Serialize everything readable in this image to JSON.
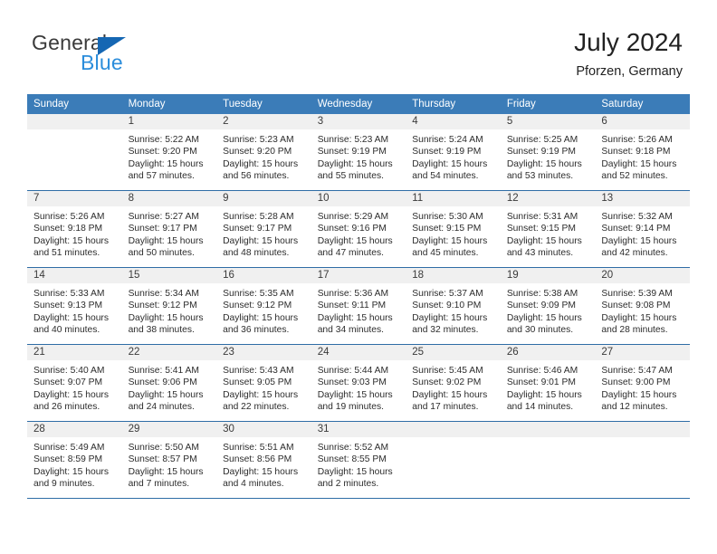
{
  "brand": {
    "name_top": "General",
    "name_bottom": "Blue",
    "triangle_color": "#1567b3",
    "blue_text_color": "#2b8ddb"
  },
  "header": {
    "title": "July 2024",
    "subtitle": "Pforzen, Germany",
    "accent_color": "#3b7cb8",
    "row_rule_color": "#2f6da6",
    "daynum_band_color": "#f0f0f0"
  },
  "weekday_headers": [
    "Sunday",
    "Monday",
    "Tuesday",
    "Wednesday",
    "Thursday",
    "Friday",
    "Saturday"
  ],
  "weeks": [
    [
      {
        "day": "",
        "sunrise": "",
        "sunset": "",
        "daylight_line1": "",
        "daylight_line2": ""
      },
      {
        "day": "1",
        "sunrise": "Sunrise: 5:22 AM",
        "sunset": "Sunset: 9:20 PM",
        "daylight_line1": "Daylight: 15 hours",
        "daylight_line2": "and 57 minutes."
      },
      {
        "day": "2",
        "sunrise": "Sunrise: 5:23 AM",
        "sunset": "Sunset: 9:20 PM",
        "daylight_line1": "Daylight: 15 hours",
        "daylight_line2": "and 56 minutes."
      },
      {
        "day": "3",
        "sunrise": "Sunrise: 5:23 AM",
        "sunset": "Sunset: 9:19 PM",
        "daylight_line1": "Daylight: 15 hours",
        "daylight_line2": "and 55 minutes."
      },
      {
        "day": "4",
        "sunrise": "Sunrise: 5:24 AM",
        "sunset": "Sunset: 9:19 PM",
        "daylight_line1": "Daylight: 15 hours",
        "daylight_line2": "and 54 minutes."
      },
      {
        "day": "5",
        "sunrise": "Sunrise: 5:25 AM",
        "sunset": "Sunset: 9:19 PM",
        "daylight_line1": "Daylight: 15 hours",
        "daylight_line2": "and 53 minutes."
      },
      {
        "day": "6",
        "sunrise": "Sunrise: 5:26 AM",
        "sunset": "Sunset: 9:18 PM",
        "daylight_line1": "Daylight: 15 hours",
        "daylight_line2": "and 52 minutes."
      }
    ],
    [
      {
        "day": "7",
        "sunrise": "Sunrise: 5:26 AM",
        "sunset": "Sunset: 9:18 PM",
        "daylight_line1": "Daylight: 15 hours",
        "daylight_line2": "and 51 minutes."
      },
      {
        "day": "8",
        "sunrise": "Sunrise: 5:27 AM",
        "sunset": "Sunset: 9:17 PM",
        "daylight_line1": "Daylight: 15 hours",
        "daylight_line2": "and 50 minutes."
      },
      {
        "day": "9",
        "sunrise": "Sunrise: 5:28 AM",
        "sunset": "Sunset: 9:17 PM",
        "daylight_line1": "Daylight: 15 hours",
        "daylight_line2": "and 48 minutes."
      },
      {
        "day": "10",
        "sunrise": "Sunrise: 5:29 AM",
        "sunset": "Sunset: 9:16 PM",
        "daylight_line1": "Daylight: 15 hours",
        "daylight_line2": "and 47 minutes."
      },
      {
        "day": "11",
        "sunrise": "Sunrise: 5:30 AM",
        "sunset": "Sunset: 9:15 PM",
        "daylight_line1": "Daylight: 15 hours",
        "daylight_line2": "and 45 minutes."
      },
      {
        "day": "12",
        "sunrise": "Sunrise: 5:31 AM",
        "sunset": "Sunset: 9:15 PM",
        "daylight_line1": "Daylight: 15 hours",
        "daylight_line2": "and 43 minutes."
      },
      {
        "day": "13",
        "sunrise": "Sunrise: 5:32 AM",
        "sunset": "Sunset: 9:14 PM",
        "daylight_line1": "Daylight: 15 hours",
        "daylight_line2": "and 42 minutes."
      }
    ],
    [
      {
        "day": "14",
        "sunrise": "Sunrise: 5:33 AM",
        "sunset": "Sunset: 9:13 PM",
        "daylight_line1": "Daylight: 15 hours",
        "daylight_line2": "and 40 minutes."
      },
      {
        "day": "15",
        "sunrise": "Sunrise: 5:34 AM",
        "sunset": "Sunset: 9:12 PM",
        "daylight_line1": "Daylight: 15 hours",
        "daylight_line2": "and 38 minutes."
      },
      {
        "day": "16",
        "sunrise": "Sunrise: 5:35 AM",
        "sunset": "Sunset: 9:12 PM",
        "daylight_line1": "Daylight: 15 hours",
        "daylight_line2": "and 36 minutes."
      },
      {
        "day": "17",
        "sunrise": "Sunrise: 5:36 AM",
        "sunset": "Sunset: 9:11 PM",
        "daylight_line1": "Daylight: 15 hours",
        "daylight_line2": "and 34 minutes."
      },
      {
        "day": "18",
        "sunrise": "Sunrise: 5:37 AM",
        "sunset": "Sunset: 9:10 PM",
        "daylight_line1": "Daylight: 15 hours",
        "daylight_line2": "and 32 minutes."
      },
      {
        "day": "19",
        "sunrise": "Sunrise: 5:38 AM",
        "sunset": "Sunset: 9:09 PM",
        "daylight_line1": "Daylight: 15 hours",
        "daylight_line2": "and 30 minutes."
      },
      {
        "day": "20",
        "sunrise": "Sunrise: 5:39 AM",
        "sunset": "Sunset: 9:08 PM",
        "daylight_line1": "Daylight: 15 hours",
        "daylight_line2": "and 28 minutes."
      }
    ],
    [
      {
        "day": "21",
        "sunrise": "Sunrise: 5:40 AM",
        "sunset": "Sunset: 9:07 PM",
        "daylight_line1": "Daylight: 15 hours",
        "daylight_line2": "and 26 minutes."
      },
      {
        "day": "22",
        "sunrise": "Sunrise: 5:41 AM",
        "sunset": "Sunset: 9:06 PM",
        "daylight_line1": "Daylight: 15 hours",
        "daylight_line2": "and 24 minutes."
      },
      {
        "day": "23",
        "sunrise": "Sunrise: 5:43 AM",
        "sunset": "Sunset: 9:05 PM",
        "daylight_line1": "Daylight: 15 hours",
        "daylight_line2": "and 22 minutes."
      },
      {
        "day": "24",
        "sunrise": "Sunrise: 5:44 AM",
        "sunset": "Sunset: 9:03 PM",
        "daylight_line1": "Daylight: 15 hours",
        "daylight_line2": "and 19 minutes."
      },
      {
        "day": "25",
        "sunrise": "Sunrise: 5:45 AM",
        "sunset": "Sunset: 9:02 PM",
        "daylight_line1": "Daylight: 15 hours",
        "daylight_line2": "and 17 minutes."
      },
      {
        "day": "26",
        "sunrise": "Sunrise: 5:46 AM",
        "sunset": "Sunset: 9:01 PM",
        "daylight_line1": "Daylight: 15 hours",
        "daylight_line2": "and 14 minutes."
      },
      {
        "day": "27",
        "sunrise": "Sunrise: 5:47 AM",
        "sunset": "Sunset: 9:00 PM",
        "daylight_line1": "Daylight: 15 hours",
        "daylight_line2": "and 12 minutes."
      }
    ],
    [
      {
        "day": "28",
        "sunrise": "Sunrise: 5:49 AM",
        "sunset": "Sunset: 8:59 PM",
        "daylight_line1": "Daylight: 15 hours",
        "daylight_line2": "and 9 minutes."
      },
      {
        "day": "29",
        "sunrise": "Sunrise: 5:50 AM",
        "sunset": "Sunset: 8:57 PM",
        "daylight_line1": "Daylight: 15 hours",
        "daylight_line2": "and 7 minutes."
      },
      {
        "day": "30",
        "sunrise": "Sunrise: 5:51 AM",
        "sunset": "Sunset: 8:56 PM",
        "daylight_line1": "Daylight: 15 hours",
        "daylight_line2": "and 4 minutes."
      },
      {
        "day": "31",
        "sunrise": "Sunrise: 5:52 AM",
        "sunset": "Sunset: 8:55 PM",
        "daylight_line1": "Daylight: 15 hours",
        "daylight_line2": "and 2 minutes."
      },
      {
        "day": "",
        "sunrise": "",
        "sunset": "",
        "daylight_line1": "",
        "daylight_line2": ""
      },
      {
        "day": "",
        "sunrise": "",
        "sunset": "",
        "daylight_line1": "",
        "daylight_line2": ""
      },
      {
        "day": "",
        "sunrise": "",
        "sunset": "",
        "daylight_line1": "",
        "daylight_line2": ""
      }
    ]
  ]
}
